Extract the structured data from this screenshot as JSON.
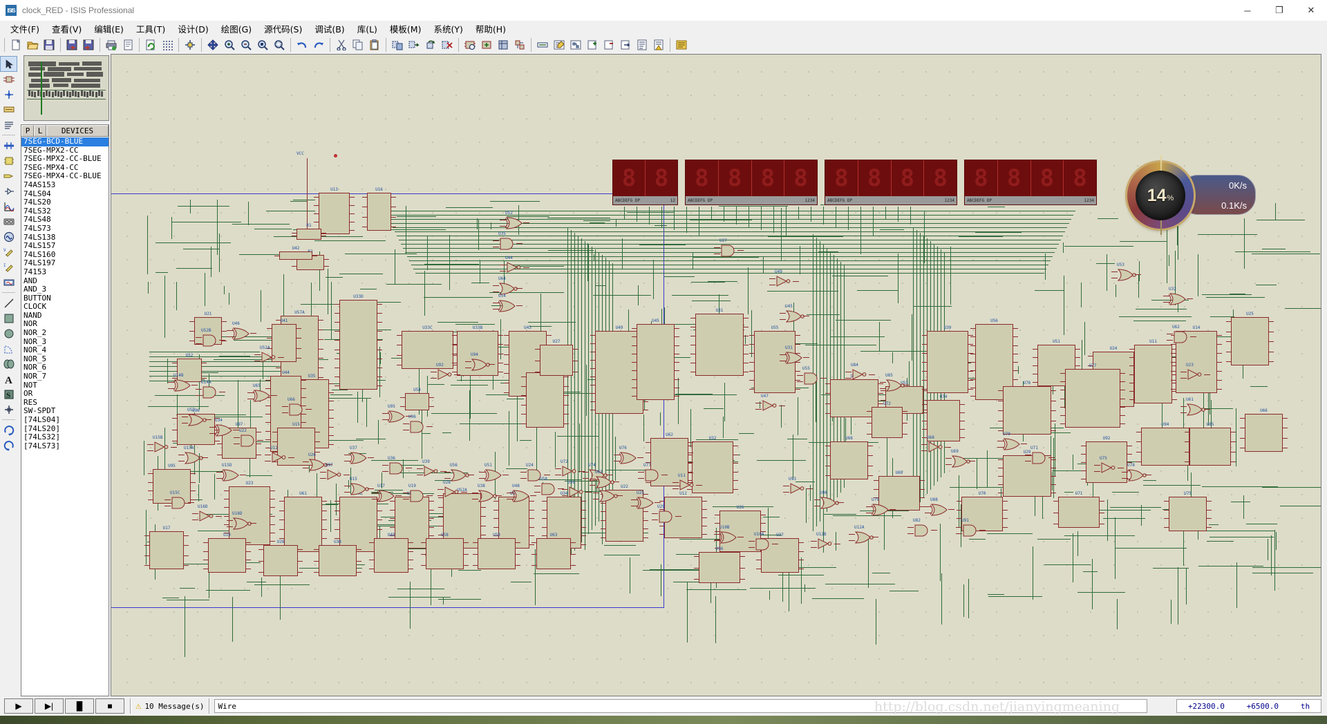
{
  "window": {
    "app_icon_text": "ISIS",
    "title": "clock_RED - ISIS Professional",
    "minimize": "─",
    "maximize": "❐",
    "close": "✕"
  },
  "menubar": {
    "items": [
      {
        "label": "文件(F)",
        "name": "menu-file"
      },
      {
        "label": "查看(V)",
        "name": "menu-view"
      },
      {
        "label": "编辑(E)",
        "name": "menu-edit"
      },
      {
        "label": "工具(T)",
        "name": "menu-tools"
      },
      {
        "label": "设计(D)",
        "name": "menu-design"
      },
      {
        "label": "绘图(G)",
        "name": "menu-graph"
      },
      {
        "label": "源代码(S)",
        "name": "menu-source"
      },
      {
        "label": "调试(B)",
        "name": "menu-debug"
      },
      {
        "label": "库(L)",
        "name": "menu-library"
      },
      {
        "label": "模板(M)",
        "name": "menu-template"
      },
      {
        "label": "系统(Y)",
        "name": "menu-system"
      },
      {
        "label": "帮助(H)",
        "name": "menu-help"
      }
    ]
  },
  "toolbar": {
    "groups": [
      [
        "new-file-icon",
        "open-file-icon",
        "save-file-icon"
      ],
      [
        "import-section-icon",
        "export-section-icon"
      ],
      [
        "print-icon",
        "print-area-icon"
      ],
      [
        "refresh-icon",
        "toggle-grid-icon"
      ],
      [
        "origin-icon"
      ],
      [
        "pan-icon",
        "zoom-in-icon",
        "zoom-out-icon",
        "zoom-sheet-icon",
        "zoom-area-icon"
      ],
      [
        "undo-icon",
        "redo-icon"
      ],
      [
        "cut-icon",
        "copy-icon",
        "paste-icon"
      ],
      [
        "block-copy-icon",
        "block-move-icon",
        "block-rotate-icon",
        "block-delete-icon"
      ],
      [
        "pick-device-icon",
        "make-device-icon",
        "packaging-tool-icon",
        "decompose-icon"
      ],
      [
        "wire-label-icon",
        "property-assign-icon",
        "design-explorer-icon",
        "new-sheet-icon",
        "remove-sheet-icon",
        "exit-sheet-icon",
        "bill-of-materials-icon",
        "erc-report-icon"
      ],
      [
        "netlist-icon"
      ]
    ]
  },
  "left_tools": {
    "items": [
      {
        "name": "selection-mode-icon",
        "glyph": "arrow"
      },
      {
        "name": "component-mode-icon",
        "glyph": "component"
      },
      {
        "name": "junction-dot-icon",
        "glyph": "junction"
      },
      {
        "name": "wire-label-mode-icon",
        "glyph": "label"
      },
      {
        "name": "text-script-mode-icon",
        "glyph": "script"
      },
      {
        "name": "bus-mode-icon",
        "glyph": "bus"
      },
      {
        "name": "subcircuit-mode-icon",
        "glyph": "subcircuit"
      },
      {
        "name": "terminals-mode-icon",
        "glyph": "terminal"
      },
      {
        "name": "device-pin-mode-icon",
        "glyph": "pin"
      },
      {
        "name": "graph-mode-icon",
        "glyph": "graph"
      },
      {
        "name": "tape-recorder-icon",
        "glyph": "tape"
      },
      {
        "name": "generator-mode-icon",
        "glyph": "generator"
      },
      {
        "name": "voltage-probe-icon",
        "glyph": "vprobe"
      },
      {
        "name": "current-probe-icon",
        "glyph": "iprobe"
      },
      {
        "name": "virtual-instruments-icon",
        "glyph": "instrument"
      },
      {
        "name": "2d-line-icon",
        "glyph": "line"
      },
      {
        "name": "2d-box-icon",
        "glyph": "box"
      },
      {
        "name": "2d-circle-icon",
        "glyph": "circle"
      },
      {
        "name": "2d-arc-icon",
        "glyph": "arc"
      },
      {
        "name": "2d-closed-path-icon",
        "glyph": "path"
      },
      {
        "name": "2d-text-icon",
        "glyph": "text"
      },
      {
        "name": "2d-symbol-icon",
        "glyph": "symbol"
      },
      {
        "name": "2d-marker-icon",
        "glyph": "marker"
      },
      {
        "name": "rotate-clockwise-icon",
        "glyph": "rotcw"
      },
      {
        "name": "rotate-anticlockwise-icon",
        "glyph": "rotccw"
      }
    ]
  },
  "devices_panel": {
    "header": {
      "p": "P",
      "l": "L",
      "devices": "DEVICES"
    },
    "items": [
      {
        "label": "7SEG-BCD-BLUE",
        "selected": true
      },
      {
        "label": "7SEG-MPX2-CC",
        "selected": false
      },
      {
        "label": "7SEG-MPX2-CC-BLUE",
        "selected": false
      },
      {
        "label": "7SEG-MPX4-CC",
        "selected": false
      },
      {
        "label": "7SEG-MPX4-CC-BLUE",
        "selected": false
      },
      {
        "label": "74AS153",
        "selected": false
      },
      {
        "label": "74LS04",
        "selected": false
      },
      {
        "label": "74LS20",
        "selected": false
      },
      {
        "label": "74LS32",
        "selected": false
      },
      {
        "label": "74LS48",
        "selected": false
      },
      {
        "label": "74LS73",
        "selected": false
      },
      {
        "label": "74LS138",
        "selected": false
      },
      {
        "label": "74LS157",
        "selected": false
      },
      {
        "label": "74LS160",
        "selected": false
      },
      {
        "label": "74LS197",
        "selected": false
      },
      {
        "label": "74153",
        "selected": false
      },
      {
        "label": "AND",
        "selected": false
      },
      {
        "label": "AND_3",
        "selected": false
      },
      {
        "label": "BUTTON",
        "selected": false
      },
      {
        "label": "CLOCK",
        "selected": false
      },
      {
        "label": "NAND",
        "selected": false
      },
      {
        "label": "NOR",
        "selected": false
      },
      {
        "label": "NOR_2",
        "selected": false
      },
      {
        "label": "NOR_3",
        "selected": false
      },
      {
        "label": "NOR_4",
        "selected": false
      },
      {
        "label": "NOR_5",
        "selected": false
      },
      {
        "label": "NOR_6",
        "selected": false
      },
      {
        "label": "NOR_7",
        "selected": false
      },
      {
        "label": "NOT",
        "selected": false
      },
      {
        "label": "OR",
        "selected": false
      },
      {
        "label": "RES",
        "selected": false
      },
      {
        "label": "SW-SPDT",
        "selected": false
      },
      {
        "label": "[74LS04]",
        "selected": false
      },
      {
        "label": "[74LS20]",
        "selected": false
      },
      {
        "label": "[74LS32]",
        "selected": false
      },
      {
        "label": "[74LS73]",
        "selected": false
      }
    ]
  },
  "schematic": {
    "power_label": "VCC",
    "displays": [
      {
        "name": "display-2digit",
        "digits": 2,
        "pin_left": "ABCDEFG  DP",
        "pin_right": "12"
      },
      {
        "name": "display-4digit-1",
        "digits": 4,
        "pin_left": "ABCDEFG  DP",
        "pin_right": "1234"
      },
      {
        "name": "display-4digit-2",
        "digits": 4,
        "pin_left": "ABCDEFG  DP",
        "pin_right": "1234"
      },
      {
        "name": "display-4digit-3",
        "digits": 4,
        "pin_left": "ABCDEFG  DP",
        "pin_right": "1234"
      }
    ],
    "component_refs": [
      "U13",
      "U16",
      "R2",
      "R1",
      "U57A",
      "U33D",
      "U33C",
      "U33B",
      "U43",
      "U42",
      "U41",
      "U21",
      "U52",
      "U35",
      "U44",
      "U64",
      "U54",
      "U27",
      "U49",
      "U45",
      "U31",
      "U55",
      "U47",
      "U53",
      "U32",
      "U62",
      "U23",
      "U61",
      "U46",
      "U52B",
      "U52A",
      "U57",
      "U34",
      "U22",
      "U12",
      "U26",
      "U37",
      "U36",
      "U39",
      "U56",
      "U51",
      "U24",
      "U72",
      "U74",
      "U76",
      "U77",
      "U11",
      "U14",
      "U25",
      "U29",
      "U92",
      "U94",
      "U95",
      "U96",
      "U97",
      "U15",
      "U17",
      "U19",
      "U28",
      "U38",
      "U48",
      "U58",
      "U59",
      "U63",
      "U65",
      "U66",
      "U68",
      "U69",
      "U70",
      "U71",
      "U75",
      "U78",
      "U79",
      "U82",
      "U84",
      "U85",
      "U88",
      "U91",
      "U93",
      "U98",
      "U10B",
      "U10A",
      "U12B",
      "U12A",
      "U14B",
      "U14A",
      "U15B",
      "U15A",
      "U15D",
      "U15C",
      "U16D",
      "U18D",
      "U18B",
      "U19B"
    ]
  },
  "cpu_widget": {
    "name": "cpu-usage-widget",
    "cpu_value": "14",
    "cpu_unit": "%",
    "upload": "0K/s",
    "download": "0.1K/s",
    "upload_arrow": "↑",
    "download_arrow": "↓"
  },
  "statusbar": {
    "animation_buttons": [
      {
        "name": "play-button",
        "glyph": "▶"
      },
      {
        "name": "step-button",
        "glyph": "▶|"
      },
      {
        "name": "pause-button",
        "glyph": "▐▌"
      },
      {
        "name": "stop-button",
        "glyph": "■"
      }
    ],
    "warning_icon": "⚠",
    "messages": "10 Message(s)",
    "mode": "Wire",
    "watermark": "http://blog.csdn.net/jianyingmeaning",
    "coord_x": "+22300.0",
    "coord_y": "+6500.0",
    "coord_suffix": "th"
  }
}
